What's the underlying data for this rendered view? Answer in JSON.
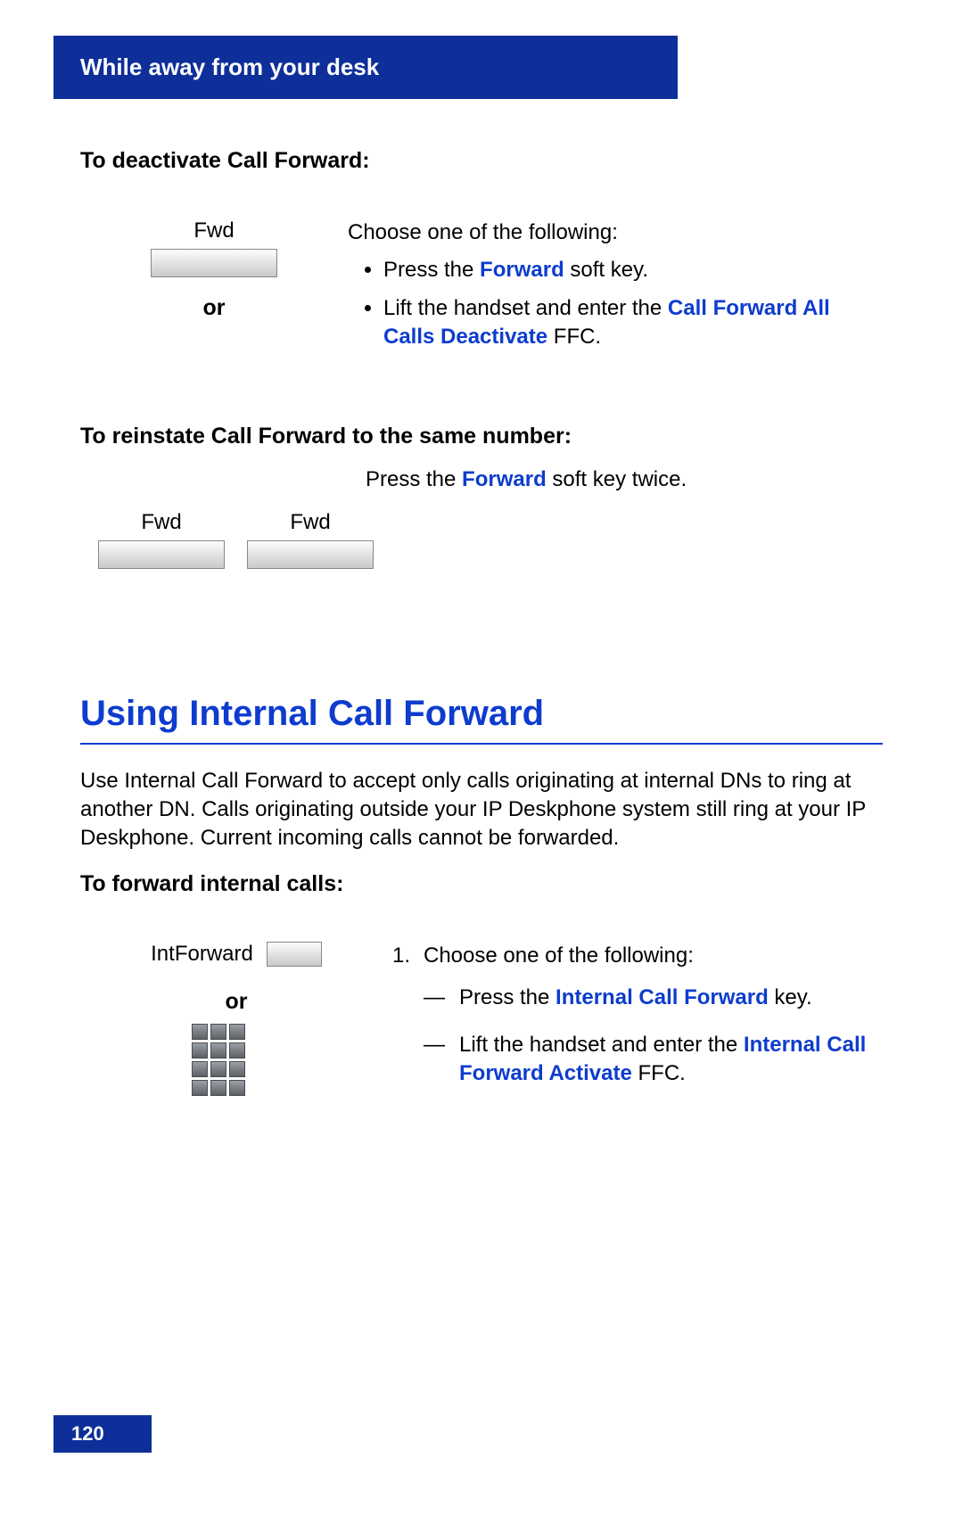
{
  "header": {
    "title": "While away from your desk"
  },
  "section1": {
    "heading": "To deactivate Call Forward:",
    "key_label": "Fwd",
    "or": "or",
    "intro": "Choose one of the following:",
    "bullet1_a": "Press the ",
    "bullet1_b": "Forward",
    "bullet1_c": " soft key.",
    "bullet2_a": "Lift the handset and enter the ",
    "bullet2_b": "Call Forward All Calls Deactivate",
    "bullet2_c": " FFC."
  },
  "section2": {
    "heading": "To reinstate Call Forward to the same number:",
    "text_a": "Press the ",
    "text_b": "Forward",
    "text_c": " soft key twice.",
    "key1": "Fwd",
    "key2": "Fwd"
  },
  "big_heading": "Using Internal Call Forward",
  "intro_para": "Use Internal Call Forward to accept only calls originating at internal DNs to ring at another DN. Calls originating outside your IP Deskphone system still ring at your IP Deskphone. Current incoming calls cannot be forwarded.",
  "section3": {
    "heading": "To forward internal calls:",
    "key_label": "IntForward",
    "or": "or",
    "step_num": "1.",
    "step_intro": "Choose one of the following:",
    "dash1_a": "Press the ",
    "dash1_b": "Internal Call Forward",
    "dash1_c": " key.",
    "dash2_a": "Lift the handset and enter the ",
    "dash2_b": "Internal Call Forward Activate",
    "dash2_c": " FFC."
  },
  "page_number": "120"
}
